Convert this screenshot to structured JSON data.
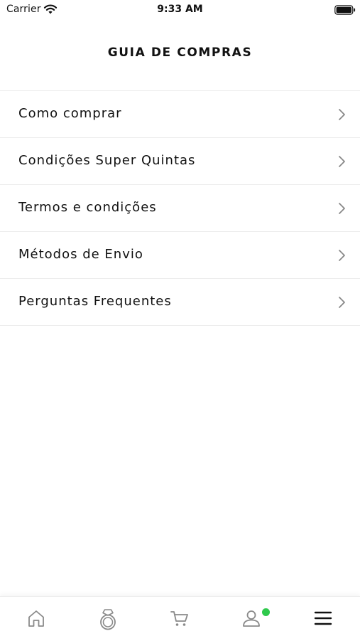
{
  "status_bar": {
    "carrier": "Carrier",
    "time": "9:33 AM"
  },
  "header": {
    "title": "GUIA DE COMPRAS"
  },
  "menu": {
    "items": [
      {
        "label": "Como comprar"
      },
      {
        "label": "Condições Super Quintas"
      },
      {
        "label": "Termos e condições"
      },
      {
        "label": "Métodos de Envio"
      },
      {
        "label": "Perguntas Frequentes"
      }
    ]
  },
  "tab_bar": {
    "tabs": [
      {
        "icon": "home-icon"
      },
      {
        "icon": "ring-icon"
      },
      {
        "icon": "cart-icon"
      },
      {
        "icon": "user-icon"
      },
      {
        "icon": "menu-icon"
      }
    ],
    "active_tab": "menu-icon",
    "icon_color": "#8a8a8a",
    "active_icon_color": "#111111",
    "notification_badge_color": "#2fc94c"
  }
}
